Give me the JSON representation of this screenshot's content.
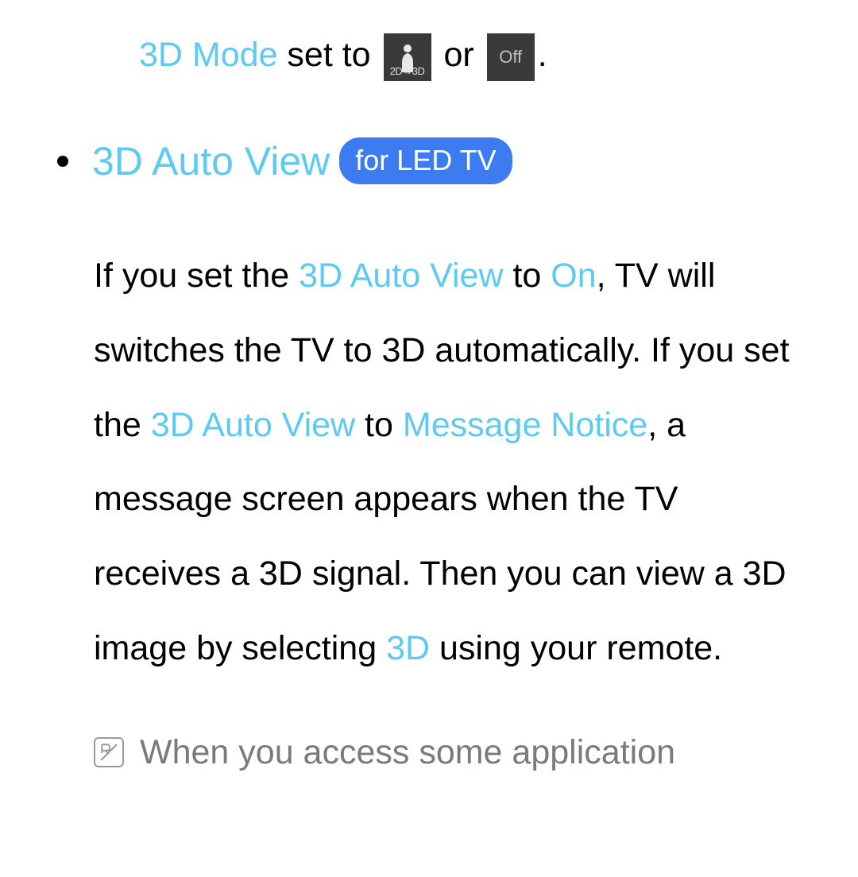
{
  "line1": {
    "mode_label": "3D Mode",
    "set_to": " set to ",
    "or": " or ",
    "period": ".",
    "icon_2d3d_label": "2D→3D",
    "icon_off_label": "Off"
  },
  "bullet": {
    "title": "3D Auto View",
    "badge": "for LED TV"
  },
  "paragraph": {
    "p1": "If you set the ",
    "p2": "3D Auto View",
    "p3": " to ",
    "p4": "On",
    "p5": ", TV will switches the TV to 3D automatically. If you set the ",
    "p6": "3D Auto View",
    "p7": " to ",
    "p8": "Message Notice",
    "p9": ", a message screen appears when the TV receives a 3D signal. Then you can view a 3D image by selecting ",
    "p10": "3D",
    "p11": " using your remote."
  },
  "note": {
    "text": "When you access some application"
  }
}
